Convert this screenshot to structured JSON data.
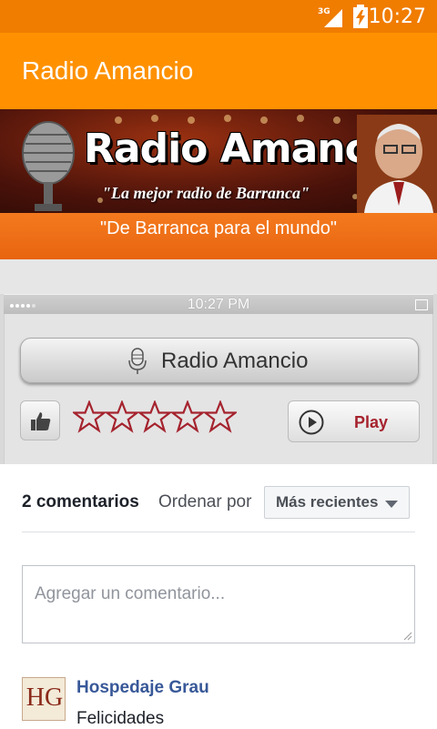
{
  "status_bar": {
    "time": "10:27",
    "network_label": "3G",
    "icons": [
      "signal-icon",
      "battery-charging-icon"
    ]
  },
  "app_bar": {
    "title": "Radio Amancio"
  },
  "banner": {
    "brand": "Radio Amancio",
    "motto": "\"La mejor radio de Barranca\"",
    "slogan": "\"De Barranca para el mundo\""
  },
  "player": {
    "inner_status_time": "10:27 PM",
    "station_label": "Radio Amancio",
    "play_label": "Play",
    "rating": {
      "filled": 0,
      "max": 5
    },
    "colors": {
      "accent": "#a5232e"
    }
  },
  "comments": {
    "count_label": "2 comentarios",
    "order_label": "Ordenar por",
    "order_value": "Más recientes",
    "input_placeholder": "Agregar un comentario...",
    "items": [
      {
        "avatar_text": "HG",
        "author": "Hospedaje Grau",
        "text": "Felicidades"
      }
    ]
  },
  "colors": {
    "status_bar": "#f07c00",
    "app_bar": "#ff9100",
    "link": "#385898"
  }
}
